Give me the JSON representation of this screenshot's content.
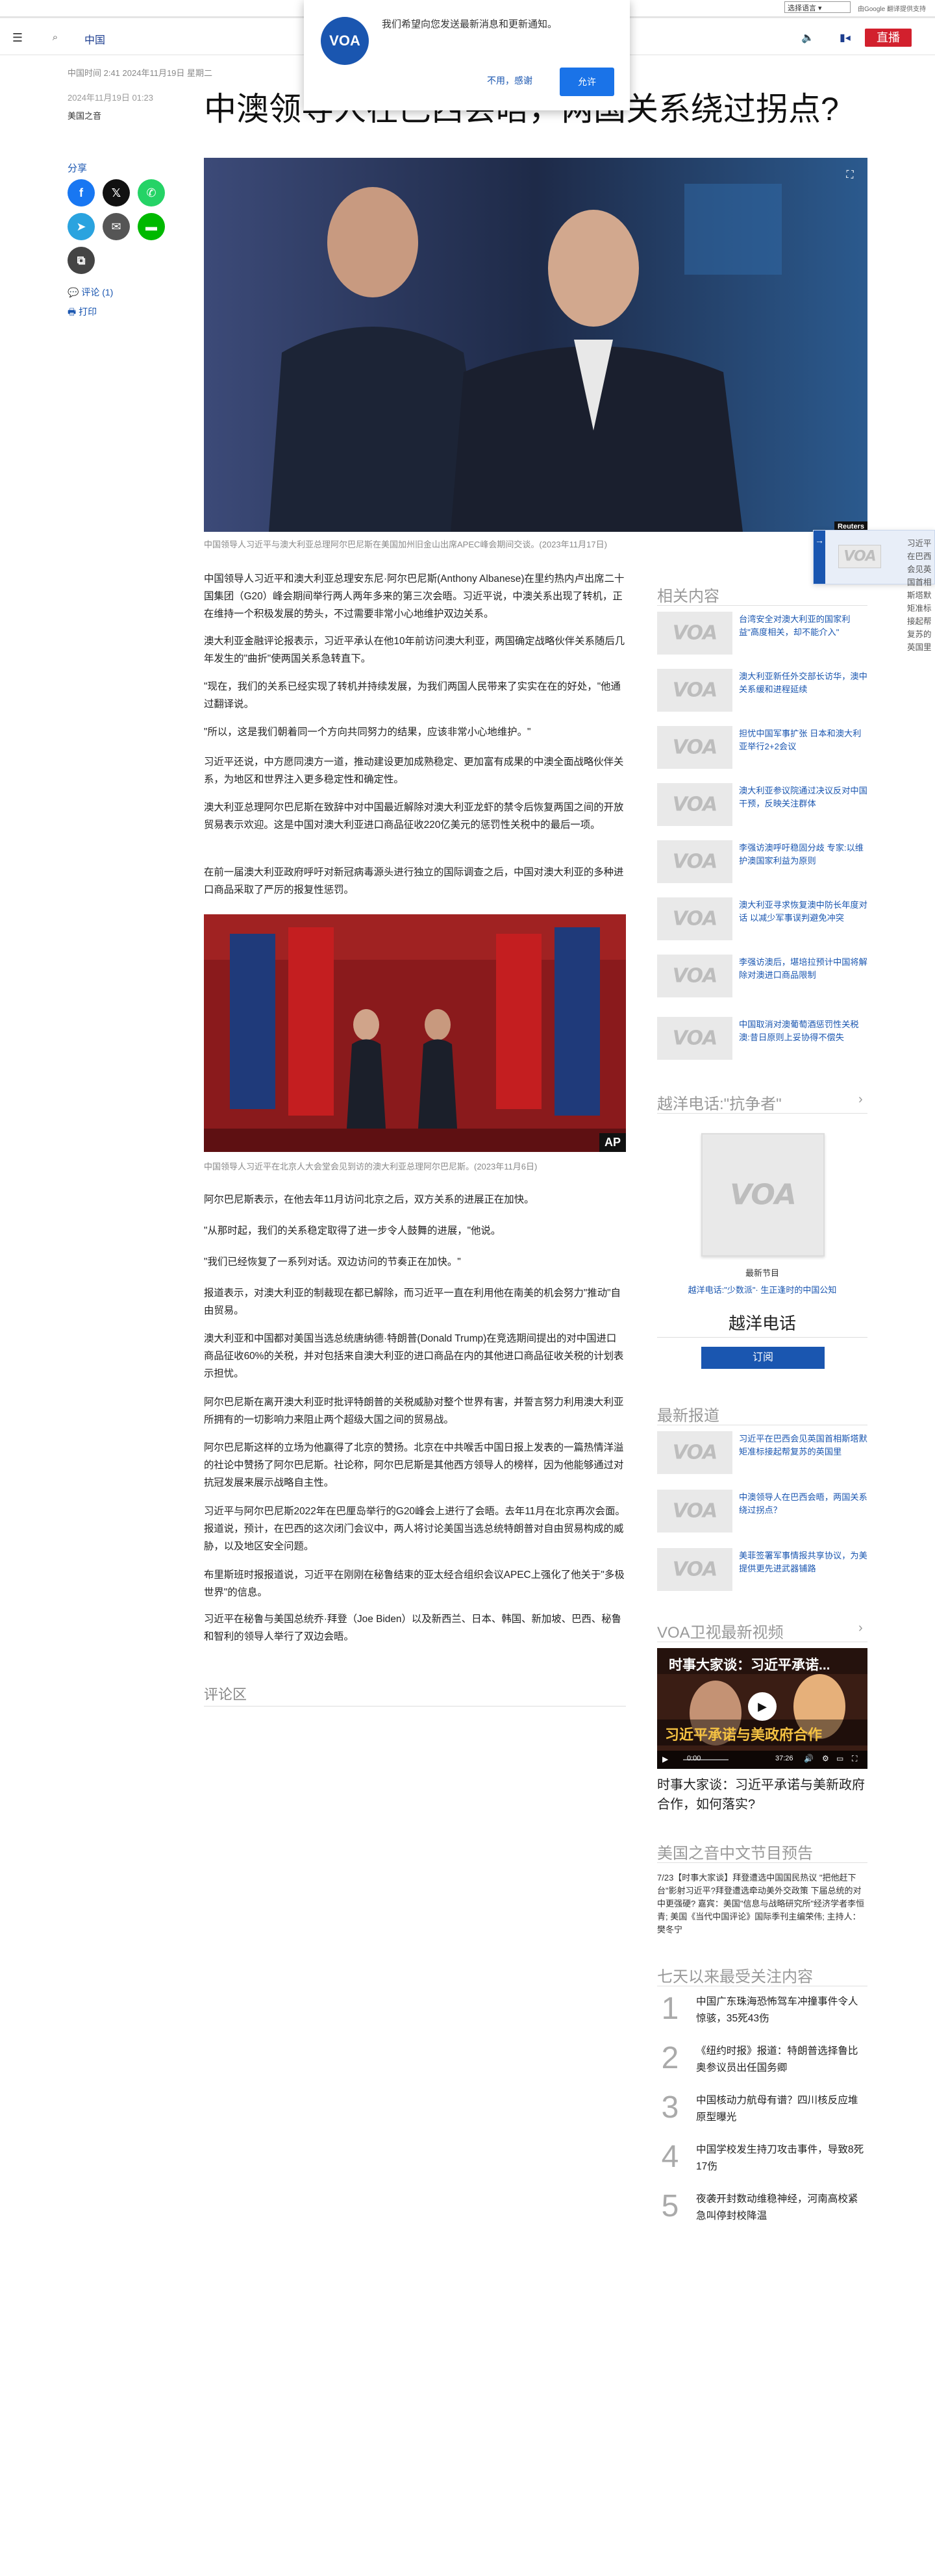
{
  "lang": {
    "select_value": "选择语言",
    "powered": "由Google 翻译提供支持"
  },
  "header": {
    "brand": "中国",
    "live": "直播"
  },
  "notification": {
    "logo": "VOA",
    "message": "我们希望向您发送最新消息和更新通知。",
    "decline": "不用，感谢",
    "allow": "允许"
  },
  "article": {
    "updated": "中国时间 2:41 2024年11月19日 星期二",
    "published": "2024年11月19日 01:23",
    "byline": "美国之音",
    "headline": "中澳领导人在巴西会晤，两国关系绕过拐点?",
    "share_label": "分享",
    "comments_link": "评论 (1)",
    "print_link": "打印",
    "hero_caption": "中国领导人习近平与澳大利亚总理阿尔巴尼斯在美国加州旧金山出席APEC峰会期间交谈。(2023年11月17日)",
    "hero_credit": "Reuters",
    "image2_caption": "中国领导人习近平在北京人大会堂会见到访的澳大利亚总理阿尔巴尼斯。(2023年11月6日)",
    "image2_credit": "AP",
    "paragraphs": [
      "中国领导人习近平和澳大利亚总理安东尼·阿尔巴尼斯(Anthony Albanese)在里约热内卢出席二十国集团（G20）峰会期间举行两人两年多来的第三次会晤。习近平说，中澳关系出现了转机，正在维持一个积极发展的势头，不过需要非常小心地维护双边关系。",
      "澳大利亚金融评论报表示，习近平承认在他10年前访问澳大利亚，两国确定战略伙伴关系随后几年发生的\"曲折\"使两国关系急转直下。",
      "\"现在，我们的关系已经实现了转机并持续发展，为我们两国人民带来了实实在在的好处，\"他通过翻译说。",
      "\"所以，这是我们朝着同一个方向共同努力的结果，应该非常小心地维护。\"",
      "习近平还说，中方愿同澳方一道，推动建设更加成熟稳定、更加富有成果的中澳全面战略伙伴关系，为地区和世界注入更多稳定性和确定性。",
      "澳大利亚总理阿尔巴尼斯在致辞中对中国最近解除对澳大利亚龙虾的禁令后恢复两国之间的开放贸易表示欢迎。这是中国对澳大利亚进口商品征收220亿美元的惩罚性关税中的最后一项。",
      "在前一届澳大利亚政府呼吁对新冠病毒源头进行独立的国际调查之后，中国对澳大利亚的多种进口商品采取了严厉的报复性惩罚。",
      "阿尔巴尼斯表示，在他去年11月访问北京之后，双方关系的进展正在加快。",
      "\"从那时起，我们的关系稳定取得了进一步令人鼓舞的进展，\"他说。",
      "\"我们已经恢复了一系列对话。双边访问的节奏正在加快。\"",
      "报道表示，对澳大利亚的制裁现在都已解除，而习近平一直在利用他在南美的机会努力\"推动\"自由贸易。",
      "澳大利亚和中国都对美国当选总统唐纳德·特朗普(Donald Trump)在竞选期间提出的对中国进口商品征收60%的关税，并对包括来自澳大利亚的进口商品在内的其他进口商品征收关税的计划表示担忧。",
      "阿尔巴尼斯在离开澳大利亚时批评特朗普的关税威胁对整个世界有害，并誓言努力利用澳大利亚所拥有的一切影响力来阻止两个超级大国之间的贸易战。",
      "阿尔巴尼斯这样的立场为他赢得了北京的赞扬。北京在中共喉舌中国日报上发表的一篇热情洋溢的社论中赞扬了阿尔巴尼斯。社论称，阿尔巴尼斯是其他西方领导人的榜样，因为他能够通过对抗冠发展来展示战略自主性。",
      "习近平与阿尔巴尼斯2022年在巴厘岛举行的G20峰会上进行了会晤。去年11月在北京再次会面。报道说，预计，在巴西的这次闭门会议中，两人将讨论美国当选总统特朗普对自由贸易构成的威胁，以及地区安全问题。",
      "布里斯班时报报道说，习近平在刚刚在秘鲁结束的亚太经合组织会议APEC上强化了他关于\"多极世界\"的信息。",
      "习近平在秘鲁与美国总统乔·拜登（Joe Biden）以及新西兰、日本、韩国、新加坡、巴西、秘鲁和智利的领导人举行了双边会晤。"
    ],
    "comments_heading": "评论区"
  },
  "sidebar": {
    "related_title": "相关内容",
    "related": [
      "台湾安全对澳大利亚的国家利益\"高度相关，却不能介入\"",
      "澳大利亚新任外交部长访华，澳中关系缓和进程延续",
      "担忧中国军事扩张 日本和澳大利亚举行2+2会议",
      "澳大利亚参议院通过决议反对中国干预，反映关注群体",
      "李强访澳呼吁稳固分歧 专家:以维护澳国家利益为原则",
      "澳大利亚寻求恢复澳中防长年度对话 以减少军事误判避免冲突",
      "李强访澳后，堪培拉预计中国将解除对澳进口商品限制",
      "中国取消对澳葡萄酒惩罚性关税 澳:昔日原则上妥协得不偿失"
    ],
    "program_section_title": "越洋电话:\"抗争者\"",
    "program_label": "最新节目",
    "program_sub": "越洋电话:\"少数派\"· 生正逢时的中国公知",
    "program_name": "越洋电话",
    "subscribe": "订阅",
    "latest_title": "最新报道",
    "latest": [
      "习近平在巴西会见英国首相斯塔默 矩准标接起帮复苏的英国里",
      "中澳领导人在巴西会晤，两国关系绕过拐点？",
      "美菲签署军事情报共享协议，为美提供更先进武器铺路"
    ],
    "video_title": "VOA卫视最新视频",
    "video_overlay_top": "时事大家谈：习近平承诺...",
    "video_overlay_big": "习近平承诺与美政府合作",
    "video_time_current": "0:00",
    "video_time_total": "37:26",
    "video_caption": "时事大家谈：习近平承诺与美新政府合作，如何落实?",
    "schedule_title": "美国之音中文节目预告",
    "schedule_text": "7/23【时事大家谈】拜登遭选中国国民热议 \"把他赶下台\"影射习近平?拜登遭选牵动美外交政策 下届总统的对中更强硬? 嘉宾：美国\"信息与战略研究所\"经济学者李恒青; 美国《当代中国评论》国际季刊主编荣伟; 主持人：樊冬宁",
    "popular_title": "七天以来最受关注内容",
    "popular": [
      {
        "num": "1",
        "text": "中国广东珠海恐怖驾车冲撞事件令人惊骇，35死43伤"
      },
      {
        "num": "2",
        "text": "《纽约时报》报道：特朗普选择鲁比奥参议员出任国务卿"
      },
      {
        "num": "3",
        "text": "中国核动力航母有谱？四川核反应堆原型曝光"
      },
      {
        "num": "4",
        "text": "中国学校发生持刀攻击事件，导致8死17伤"
      },
      {
        "num": "5",
        "text": "夜袭开封数动维稳神经，河南高校紧急叫停封校降温"
      }
    ]
  },
  "float_card": {
    "logo": "VOA",
    "text": "习近平在巴西会见英国首相斯塔默 矩准标接起帮复苏的英国里"
  }
}
